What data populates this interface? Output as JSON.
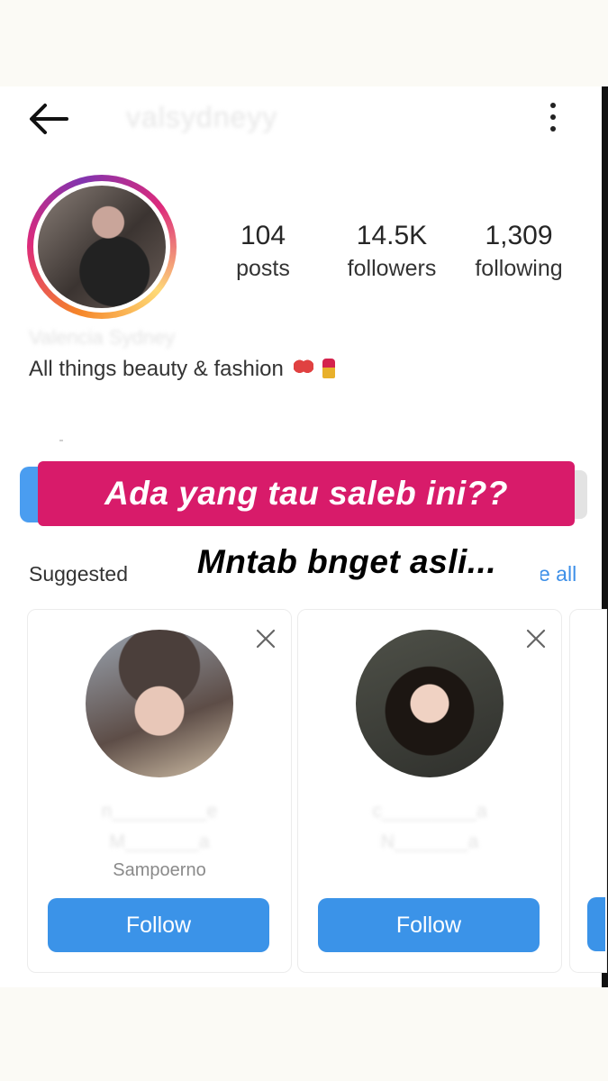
{
  "header": {
    "username": "valsydneyy",
    "back_icon": "arrow-left-icon",
    "menu_icon": "more-vertical-icon"
  },
  "profile": {
    "stats": [
      {
        "value": "104",
        "label": "posts"
      },
      {
        "value": "14.5K",
        "label": "followers"
      },
      {
        "value": "1,309",
        "label": "following"
      }
    ],
    "full_name": "Valencia Sydney",
    "bio": "All things beauty & fashion"
  },
  "overlay": {
    "caption_top": "Ada yang tau saleb ini??",
    "caption_bottom": "Mntab bnget asli..."
  },
  "suggested": {
    "label": "Suggested",
    "see_all": "e all",
    "cards": [
      {
        "username": "n_________e",
        "subname": "M_______a",
        "extra": "Sampoerno",
        "follow_label": "Follow"
      },
      {
        "username": "c_________a",
        "subname": "N_______a",
        "extra": "",
        "follow_label": "Follow"
      }
    ]
  },
  "colors": {
    "caption_bg": "#d81b6a",
    "follow_bg": "#3b93e8",
    "link": "#3d8fe8"
  }
}
